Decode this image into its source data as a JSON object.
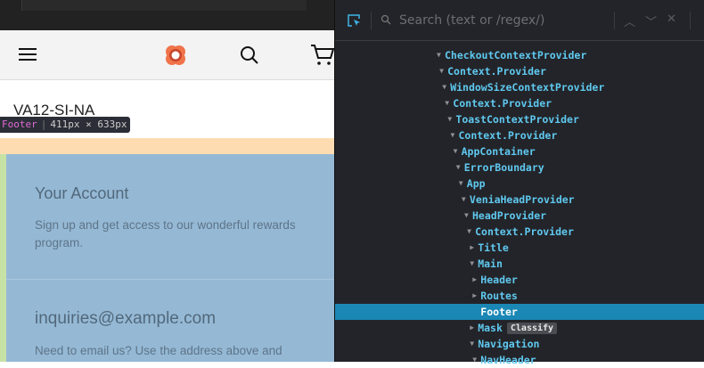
{
  "page": {
    "title": "VA12-SI-NA",
    "inspector_tooltip": {
      "component": "Footer",
      "size": "411px × 633px"
    },
    "footer": {
      "account_heading": "Your Account",
      "account_text": "Sign up and get access to our wonderful rewards program.",
      "email_heading": "inquiries@example.com",
      "email_text": "Need to email us? Use the address above and"
    }
  },
  "devtools": {
    "search_placeholder": "Search (text or /regex/)",
    "tree": [
      {
        "label": "CheckoutContextProvider",
        "depth": 0,
        "state": "expanded"
      },
      {
        "label": "Context.Provider",
        "depth": 1,
        "state": "expanded"
      },
      {
        "label": "WindowSizeContextProvider",
        "depth": 2,
        "state": "expanded"
      },
      {
        "label": "Context.Provider",
        "depth": 3,
        "state": "expanded"
      },
      {
        "label": "ToastContextProvider",
        "depth": 4,
        "state": "expanded"
      },
      {
        "label": "Context.Provider",
        "depth": 5,
        "state": "expanded"
      },
      {
        "label": "AppContainer",
        "depth": 6,
        "state": "expanded"
      },
      {
        "label": "ErrorBoundary",
        "depth": 7,
        "state": "expanded"
      },
      {
        "label": "App",
        "depth": 8,
        "state": "expanded"
      },
      {
        "label": "VeniaHeadProvider",
        "depth": 9,
        "state": "expanded"
      },
      {
        "label": "HeadProvider",
        "depth": 10,
        "state": "expanded"
      },
      {
        "label": "Context.Provider",
        "depth": 11,
        "state": "expanded"
      },
      {
        "label": "Title",
        "depth": 12,
        "state": "collapsed"
      },
      {
        "label": "Main",
        "depth": 12,
        "state": "expanded"
      },
      {
        "label": "Header",
        "depth": 13,
        "state": "collapsed"
      },
      {
        "label": "Routes",
        "depth": 13,
        "state": "collapsed"
      },
      {
        "label": "Footer",
        "depth": 13,
        "state": "leaf",
        "selected": true
      },
      {
        "label": "Mask",
        "depth": 12,
        "state": "collapsed",
        "badge": "Classify"
      },
      {
        "label": "Navigation",
        "depth": 12,
        "state": "expanded"
      },
      {
        "label": "NavHeader",
        "depth": 13,
        "state": "expanded"
      }
    ]
  }
}
